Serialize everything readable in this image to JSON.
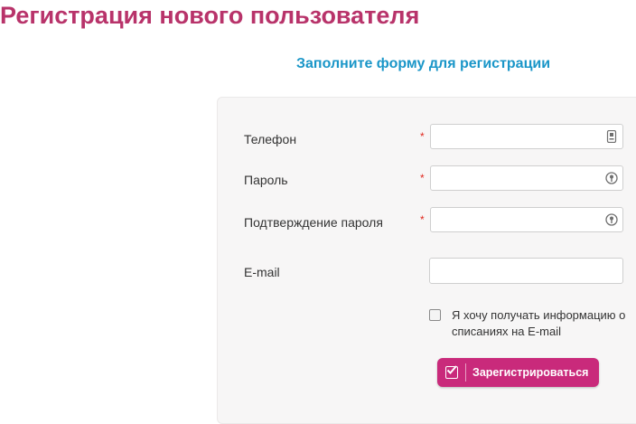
{
  "page": {
    "title": "Регистрация нового пользователя",
    "subtitle": "Заполните форму для регистрации"
  },
  "form": {
    "fields": [
      {
        "label": "Телефон",
        "required": true,
        "value": "",
        "icon": "phone-icon"
      },
      {
        "label": "Пароль",
        "required": true,
        "value": "",
        "icon": "key-icon"
      },
      {
        "label": "Подтверждение пароля",
        "required": true,
        "value": "",
        "icon": "key-icon"
      },
      {
        "label": "E-mail",
        "required": false,
        "value": ""
      }
    ],
    "required_mark": "*",
    "newsletter": {
      "label": "Я хочу получать информацию о списаниях на E-mail",
      "checked": false
    },
    "submit_label": "Зарегистрироваться"
  },
  "colors": {
    "title": "#b8336a",
    "subtitle": "#1a96c8",
    "button": "#c92a7b",
    "required": "#e0281e"
  }
}
